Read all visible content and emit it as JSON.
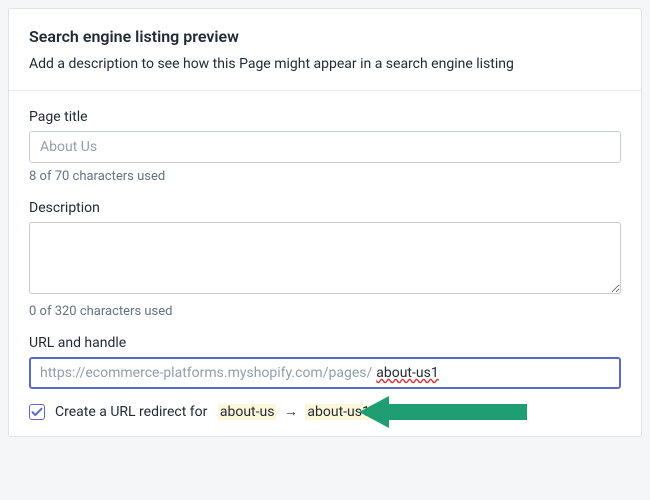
{
  "header": {
    "title": "Search engine listing preview",
    "subtitle": "Add a description to see how this Page might appear in a search engine listing"
  },
  "pageTitle": {
    "label": "Page title",
    "placeholder": "About Us",
    "value": "",
    "charCount": "8 of 70 characters used"
  },
  "description": {
    "label": "Description",
    "value": "",
    "charCount": "0 of 320 characters used"
  },
  "url": {
    "label": "URL and handle",
    "prefix": "https://ecommerce-platforms.myshopify.com/pages/",
    "handle": "about-us1"
  },
  "redirect": {
    "checked": true,
    "labelPrefix": "Create a URL redirect for",
    "from": "about-us",
    "to": "about-us1"
  }
}
